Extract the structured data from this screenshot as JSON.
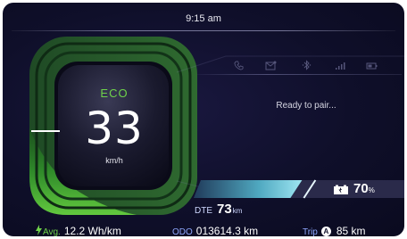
{
  "header": {
    "time": "9:15 am"
  },
  "status_icons": [
    "phone-icon",
    "message-icon",
    "bluetooth-icon",
    "signal-icon",
    "battery-small-icon"
  ],
  "pairing": {
    "status": "Ready to pair..."
  },
  "gauge": {
    "mode": "ECO",
    "speed": "33",
    "speed_unit": "km/h"
  },
  "battery": {
    "percent": "70",
    "percent_unit": "%",
    "level_fraction": 0.7
  },
  "dte": {
    "label": "DTE",
    "value": "73",
    "unit": "km"
  },
  "footer": {
    "avg_label": "Avg.",
    "avg_value": "12.2 Wh/km",
    "odo_label": "ODO",
    "odo_value": "013614.3 km",
    "trip_label": "Trip",
    "trip_badge": "A",
    "trip_value": "85 km"
  },
  "colors": {
    "accent_green": "#6fd24a",
    "accent_blue": "#8fa8ff",
    "background": "#0f0f2a",
    "battery_teal": "#7ad6e6"
  }
}
